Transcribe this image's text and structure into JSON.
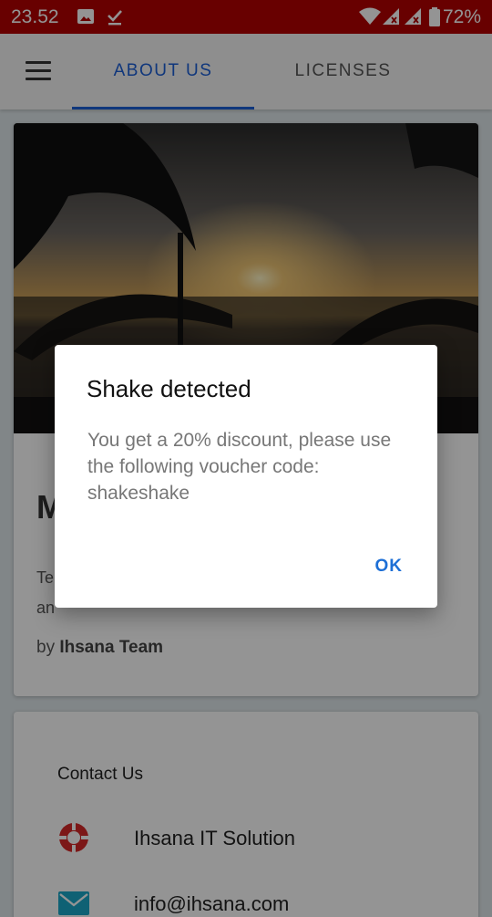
{
  "status_bar": {
    "time": "23.52",
    "battery": "72%",
    "icons": [
      "image-icon",
      "download-done-icon",
      "wifi-icon",
      "signal-icon",
      "signal-icon",
      "battery-icon"
    ],
    "background_color": "#b30000"
  },
  "app_bar": {
    "menu_icon": "hamburger-menu-icon",
    "tabs": [
      {
        "label": "ABOUT US",
        "active": true
      },
      {
        "label": "LICENSES",
        "active": false
      }
    ],
    "accent_color": "#1d5fd6"
  },
  "about_card": {
    "title_visible": "M",
    "description_partial_line1": "Te",
    "description_partial_line2": "an",
    "by_prefix": "by",
    "author": "Ihsana Team"
  },
  "contact_card": {
    "title": "Contact Us",
    "items": [
      {
        "icon": "lifebuoy-icon",
        "text": "Ihsana IT Solution"
      },
      {
        "icon": "email-icon",
        "text": "info@ihsana.com"
      }
    ]
  },
  "dialog": {
    "title": "Shake detected",
    "message": "You get a 20% discount, please use the following voucher code: shakeshake",
    "ok_label": "OK"
  }
}
